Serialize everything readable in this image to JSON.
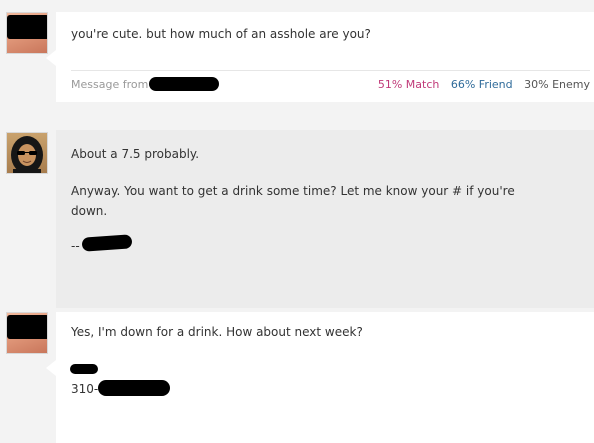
{
  "messages": [
    {
      "text": "you're cute. but how much of an asshole are you?",
      "meta_label": "Message from",
      "match": "51% Match",
      "friend": "66% Friend",
      "enemy": "30% Enemy"
    },
    {
      "line1": "About a 7.5 probably.",
      "line2": "Anyway. You want to get a drink some time? Let me know your # if you're down.",
      "signature_prefix": "--"
    },
    {
      "line1": "Yes, I'm down for a drink. How about next week?",
      "phone_prefix": "310-"
    }
  ],
  "colors": {
    "match": "#c03a79",
    "friend": "#2f6b9a",
    "bubble_gray": "#ececec"
  }
}
